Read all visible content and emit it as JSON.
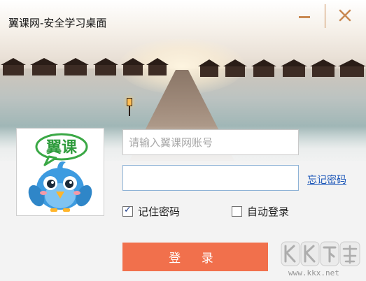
{
  "window": {
    "title": "翼课网-安全学习桌面",
    "controls": {
      "minimize_icon": "minimize-icon",
      "close_icon": "close-icon"
    }
  },
  "banner": {
    "scene": "sunset-pier-with-water-bungalows"
  },
  "avatar": {
    "badge_text": "翼课",
    "mascot": "blue-bird"
  },
  "login_form": {
    "account": {
      "placeholder": "请输入翼课网账号",
      "value": ""
    },
    "password": {
      "placeholder": "",
      "value": ""
    },
    "forgot_password": "忘记密码",
    "remember_password": {
      "label": "记住密码",
      "checked": true
    },
    "auto_login": {
      "label": "自动登录",
      "checked": false
    },
    "login_button": "登 录"
  },
  "watermark": {
    "logo_text": "KK下载",
    "url_text": "www.kkx.net"
  },
  "colors": {
    "accent": "#f1704c",
    "link": "#1a55b8",
    "window_control": "#c98a53",
    "input_focus_border": "#8fb3d6"
  }
}
